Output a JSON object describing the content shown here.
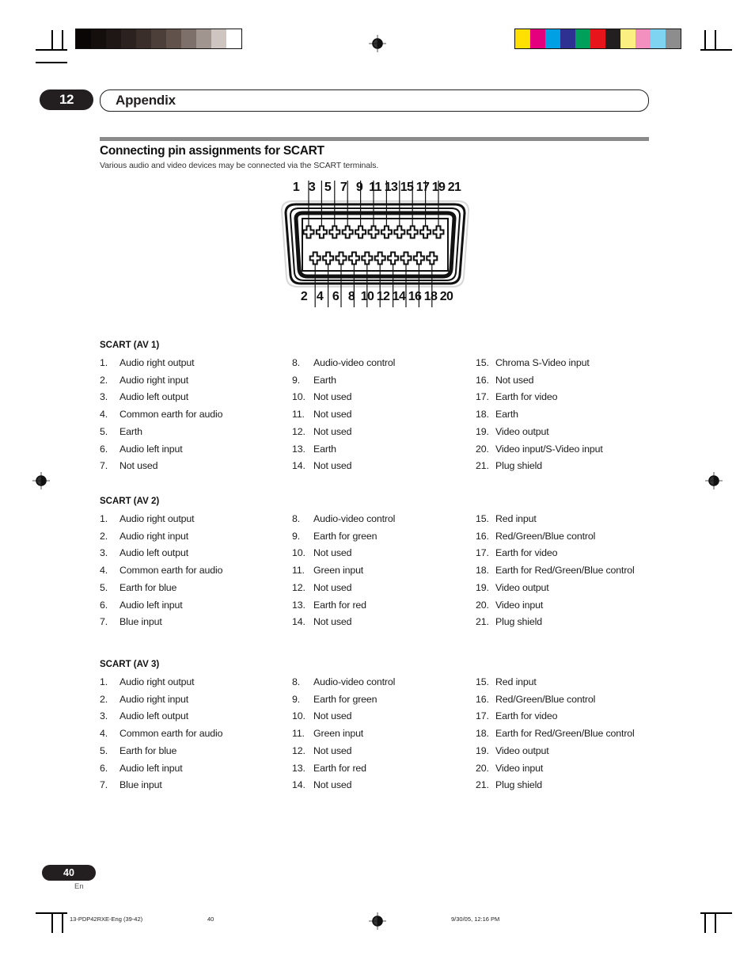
{
  "chapter": {
    "number": "12",
    "title": "Appendix"
  },
  "section": {
    "title": "Connecting pin assignments for SCART",
    "subtitle": "Various audio and video devices may be connected via the SCART terminals."
  },
  "connector": {
    "top_pin_labels": [
      "1",
      "3",
      "5",
      "7",
      "9",
      "11",
      "13",
      "15",
      "17",
      "19",
      "21"
    ],
    "bottom_pin_labels": [
      "2",
      "4",
      "6",
      "8",
      "10",
      "12",
      "14",
      "16",
      "18",
      "20"
    ],
    "top_pin_count": 11,
    "bottom_pin_count": 10
  },
  "pin_sections": [
    {
      "title": "SCART (AV 1)",
      "col1": [
        {
          "idx": "1.",
          "txt": "Audio right output"
        },
        {
          "idx": "2.",
          "txt": "Audio right input"
        },
        {
          "idx": "3.",
          "txt": "Audio left output"
        },
        {
          "idx": "4.",
          "txt": "Common earth for audio"
        },
        {
          "idx": "5.",
          "txt": "Earth"
        },
        {
          "idx": "6.",
          "txt": "Audio left input"
        },
        {
          "idx": "7.",
          "txt": "Not used"
        }
      ],
      "col2": [
        {
          "idx": "8.",
          "txt": "Audio-video control"
        },
        {
          "idx": "9.",
          "txt": "Earth"
        },
        {
          "idx": "10.",
          "txt": "Not used"
        },
        {
          "idx": "11.",
          "txt": "Not used"
        },
        {
          "idx": "12.",
          "txt": "Not used"
        },
        {
          "idx": "13.",
          "txt": "Earth"
        },
        {
          "idx": "14.",
          "txt": "Not used"
        }
      ],
      "col3": [
        {
          "idx": "15.",
          "txt": "Chroma S-Video input"
        },
        {
          "idx": "16.",
          "txt": "Not used"
        },
        {
          "idx": "17.",
          "txt": "Earth for video"
        },
        {
          "idx": "18.",
          "txt": "Earth"
        },
        {
          "idx": "19.",
          "txt": "Video output"
        },
        {
          "idx": "20.",
          "txt": "Video input/S-Video input"
        },
        {
          "idx": "21.",
          "txt": "Plug shield"
        }
      ]
    },
    {
      "title": "SCART (AV 2)",
      "col1": [
        {
          "idx": "1.",
          "txt": "Audio right output"
        },
        {
          "idx": "2.",
          "txt": "Audio right input"
        },
        {
          "idx": "3.",
          "txt": "Audio left output"
        },
        {
          "idx": "4.",
          "txt": "Common earth for audio"
        },
        {
          "idx": "5.",
          "txt": "Earth for blue"
        },
        {
          "idx": "6.",
          "txt": "Audio left input"
        },
        {
          "idx": "7.",
          "txt": "Blue input"
        }
      ],
      "col2": [
        {
          "idx": "8.",
          "txt": "Audio-video control"
        },
        {
          "idx": "9.",
          "txt": "Earth for green"
        },
        {
          "idx": "10.",
          "txt": "Not used"
        },
        {
          "idx": "11.",
          "txt": "Green input"
        },
        {
          "idx": "12.",
          "txt": "Not used"
        },
        {
          "idx": "13.",
          "txt": "Earth for red"
        },
        {
          "idx": "14.",
          "txt": "Not used"
        }
      ],
      "col3": [
        {
          "idx": "15.",
          "txt": "Red input"
        },
        {
          "idx": "16.",
          "txt": "Red/Green/Blue control"
        },
        {
          "idx": "17.",
          "txt": "Earth for video"
        },
        {
          "idx": "18.",
          "txt": "Earth for Red/Green/Blue control"
        },
        {
          "idx": "19.",
          "txt": "Video output"
        },
        {
          "idx": "20.",
          "txt": "Video input"
        },
        {
          "idx": "21.",
          "txt": "Plug shield"
        }
      ]
    },
    {
      "title": "SCART (AV 3)",
      "col1": [
        {
          "idx": "1.",
          "txt": "Audio right output"
        },
        {
          "idx": "2.",
          "txt": "Audio right input"
        },
        {
          "idx": "3.",
          "txt": "Audio left output"
        },
        {
          "idx": "4.",
          "txt": "Common earth for audio"
        },
        {
          "idx": "5.",
          "txt": "Earth for blue"
        },
        {
          "idx": "6.",
          "txt": "Audio left input"
        },
        {
          "idx": "7.",
          "txt": "Blue input"
        }
      ],
      "col2": [
        {
          "idx": "8.",
          "txt": "Audio-video control"
        },
        {
          "idx": "9.",
          "txt": "Earth for green"
        },
        {
          "idx": "10.",
          "txt": "Not used"
        },
        {
          "idx": "11.",
          "txt": "Green input"
        },
        {
          "idx": "12.",
          "txt": "Not used"
        },
        {
          "idx": "13.",
          "txt": "Earth for red"
        },
        {
          "idx": "14.",
          "txt": "Not used"
        }
      ],
      "col3": [
        {
          "idx": "15.",
          "txt": "Red input"
        },
        {
          "idx": "16.",
          "txt": "Red/Green/Blue control"
        },
        {
          "idx": "17.",
          "txt": "Earth for video"
        },
        {
          "idx": "18.",
          "txt": "Earth for Red/Green/Blue control"
        },
        {
          "idx": "19.",
          "txt": "Video output"
        },
        {
          "idx": "20.",
          "txt": "Video input"
        },
        {
          "idx": "21.",
          "txt": "Plug shield"
        }
      ]
    }
  ],
  "footer": {
    "page_number": "40",
    "language": "En",
    "slug_left": "13-PDP42RXE-Eng (39-42)",
    "slug_page": "40",
    "slug_right": "9/30/05, 12:16 PM"
  },
  "press_marks": {
    "grayscale_swatches": [
      "#0a0606",
      "#140e0d",
      "#1e1715",
      "#2b221f",
      "#3a2e2a",
      "#4c3e39",
      "#61524c",
      "#7d6f69",
      "#a1968f",
      "#cfc5c0",
      "#ffffff"
    ],
    "color_swatches": [
      "#ffe000",
      "#e5007e",
      "#00a0e4",
      "#2e3192",
      "#00a05a",
      "#e8141b",
      "#231f20",
      "#fbef82",
      "#f490c0",
      "#7fd4f2",
      "#8d8d8d"
    ]
  }
}
